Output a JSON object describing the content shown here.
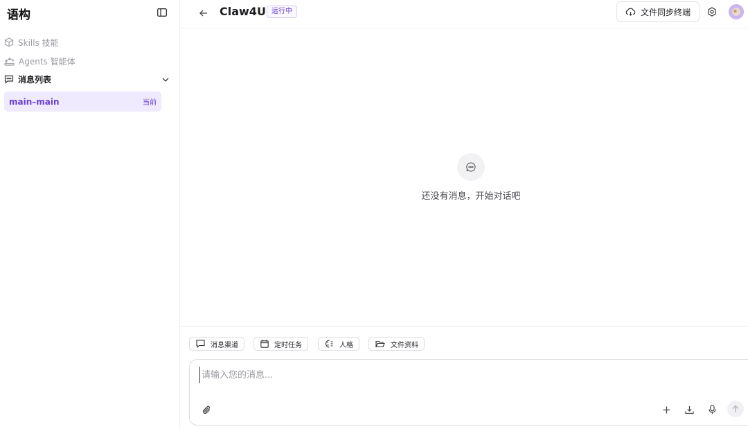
{
  "sidebar": {
    "brand": "语构",
    "items": [
      {
        "label": "Skills 技能",
        "icon": "cube-icon"
      },
      {
        "label": "Agents 智能体",
        "icon": "robot-arm-icon"
      },
      {
        "label": "消息列表",
        "icon": "message-square-icon",
        "expanded": true
      }
    ],
    "conversations": [
      {
        "name": "main–main",
        "tag": "当前"
      }
    ]
  },
  "header": {
    "title": "Claw4U",
    "status": "运行中",
    "sync_label": "文件同步终端"
  },
  "main": {
    "empty_text": "还没有消息，开始对话吧"
  },
  "composer": {
    "chips": [
      "消息渠道",
      "定时任务",
      "人格",
      "文件资料"
    ],
    "placeholder": "请输入您的消息..."
  },
  "colors": {
    "accent": "#6b3fd1",
    "accent_bg": "#efeafd",
    "border": "#ececef"
  }
}
